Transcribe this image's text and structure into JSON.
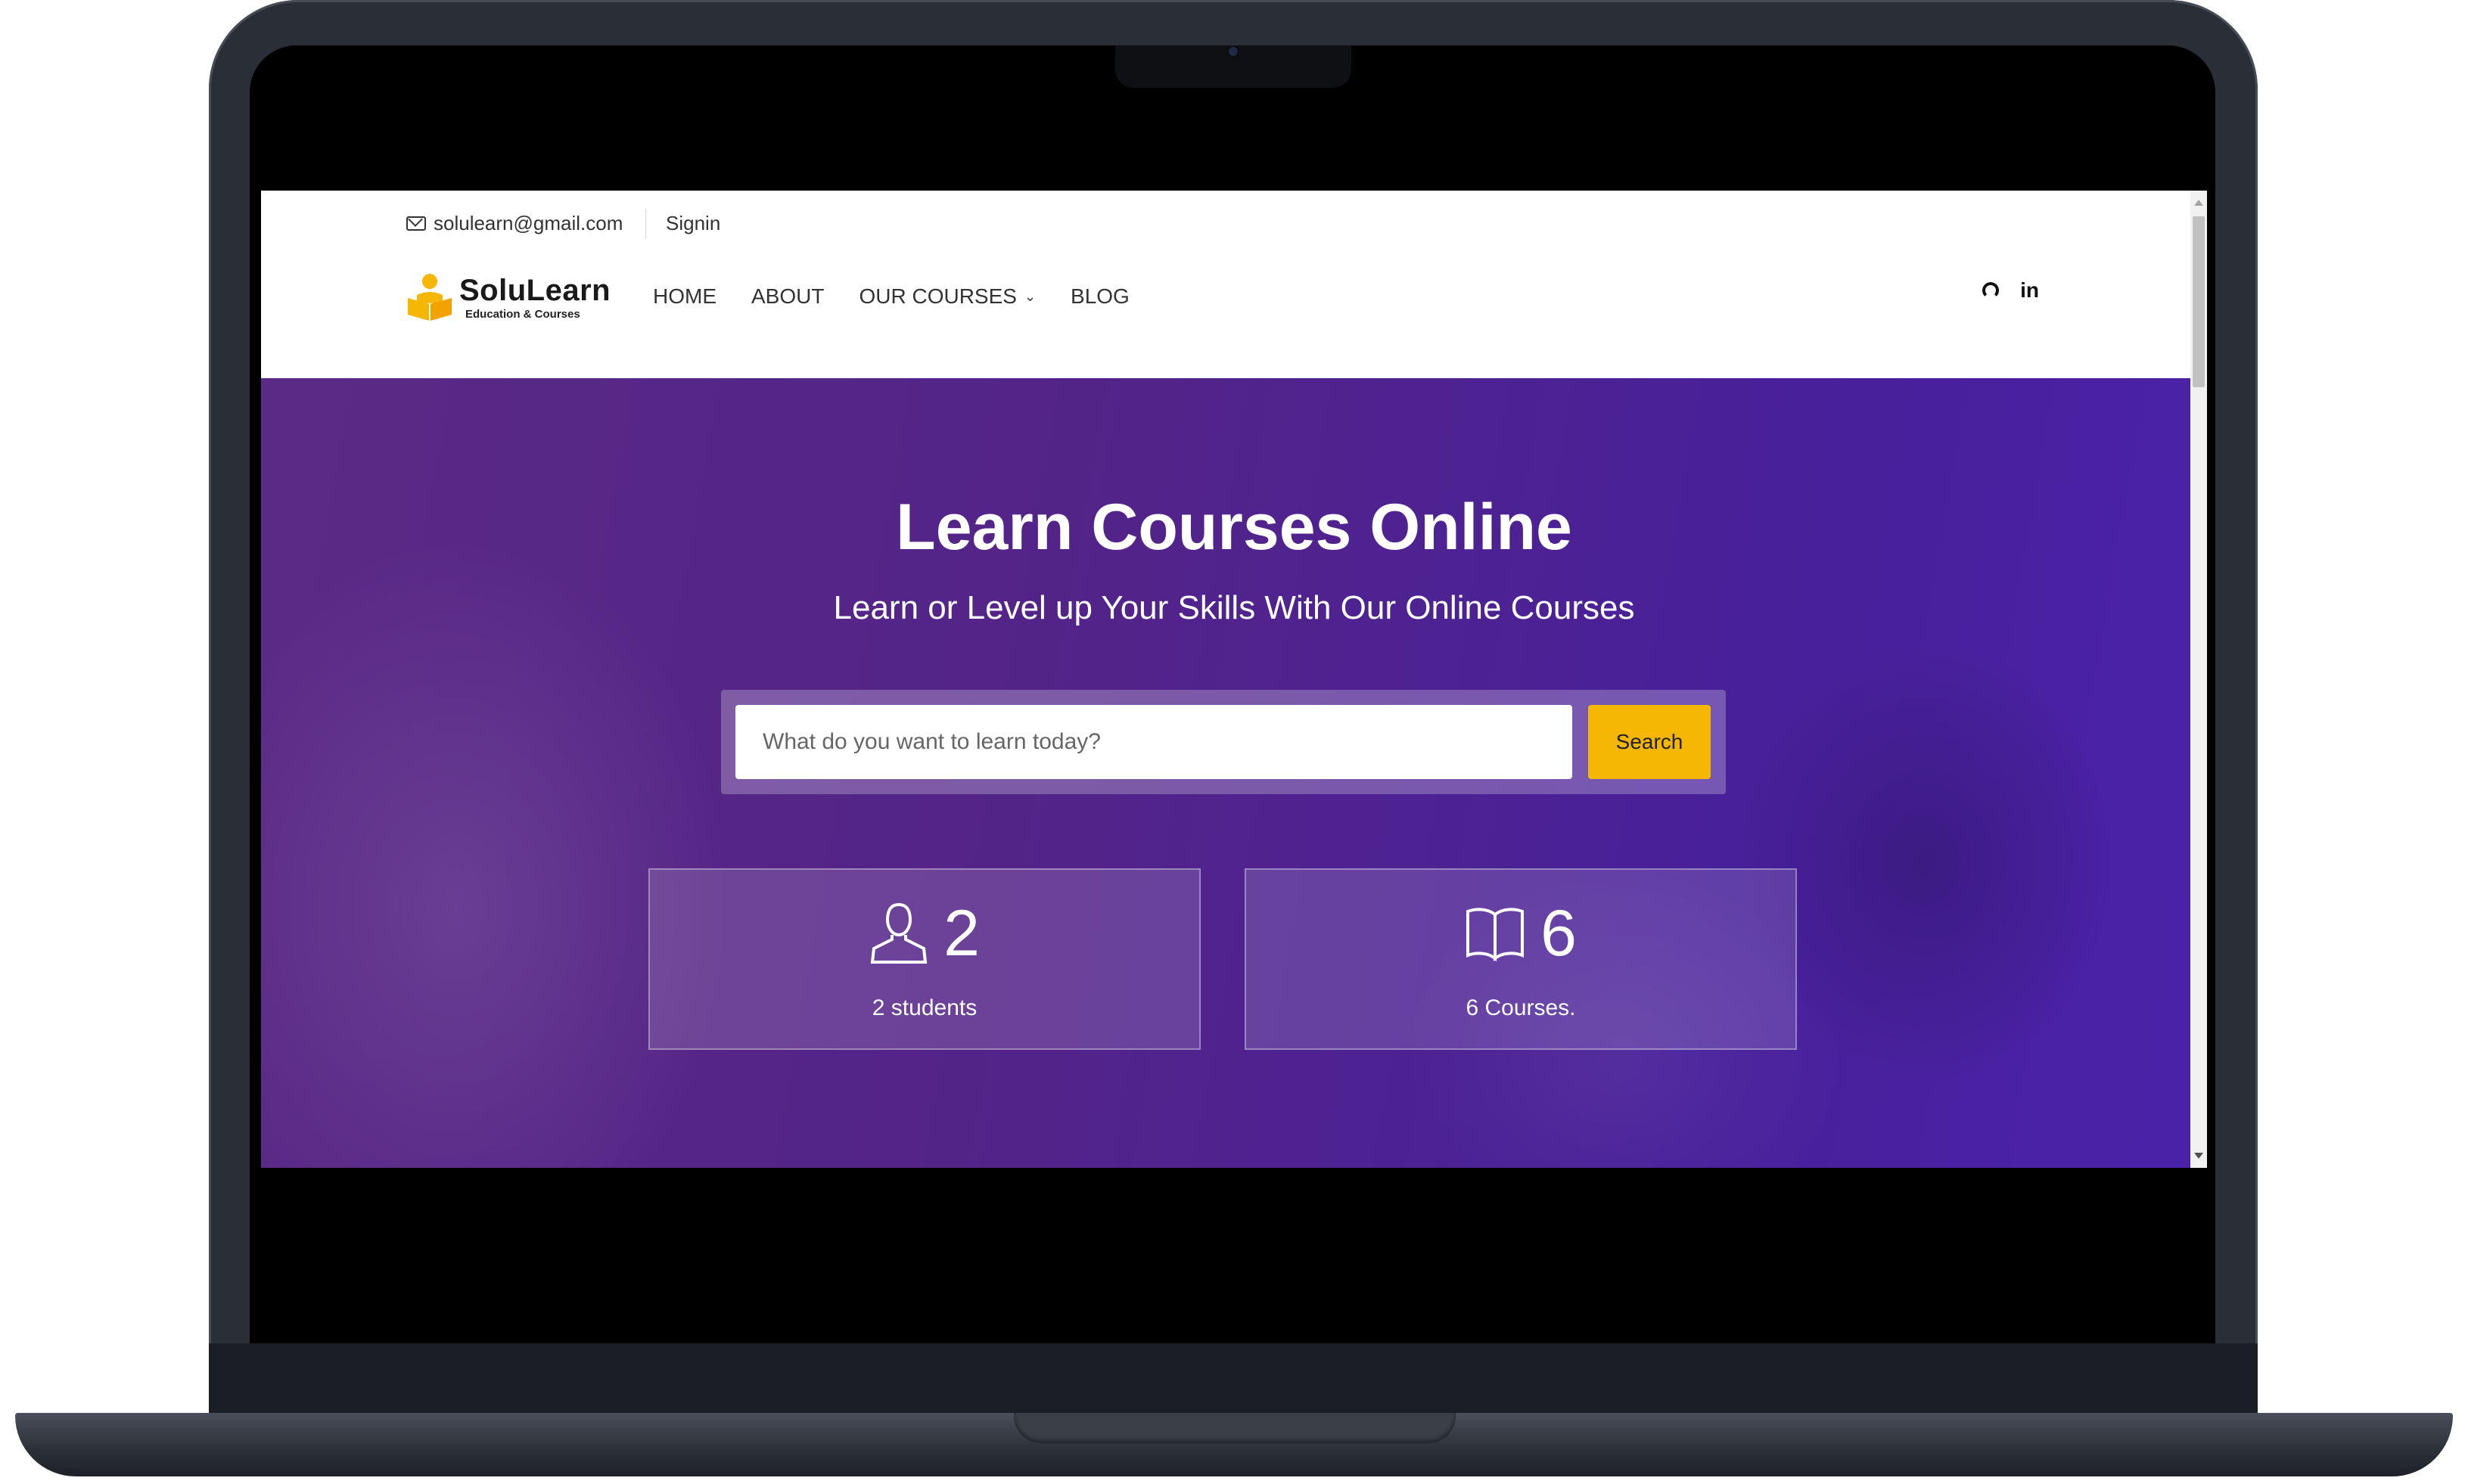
{
  "topbar": {
    "email": "solulearn@gmail.com",
    "signin": "Signin"
  },
  "brand": {
    "name": "SoluLearn",
    "tagline": "Education & Courses",
    "accent": "#f6b604"
  },
  "nav": {
    "items": [
      {
        "label": "HOME"
      },
      {
        "label": "ABOUT"
      },
      {
        "label": "OUR COURSES",
        "icon": "chevron-down-icon"
      },
      {
        "label": "BLOG"
      }
    ],
    "social": [
      "github-icon",
      "linkedin-icon"
    ],
    "linkedin_glyph": "in"
  },
  "hero": {
    "title": "Learn Courses Online",
    "subtitle": "Learn or Level up Your Skills With Our Online Courses",
    "background": "#532488"
  },
  "search": {
    "placeholder": "What do you want to learn today?",
    "button": "Search"
  },
  "stats": [
    {
      "icon": "user-icon",
      "value": "2",
      "label": "2 students"
    },
    {
      "icon": "book-icon",
      "value": "6",
      "label": "6 Courses."
    }
  ]
}
